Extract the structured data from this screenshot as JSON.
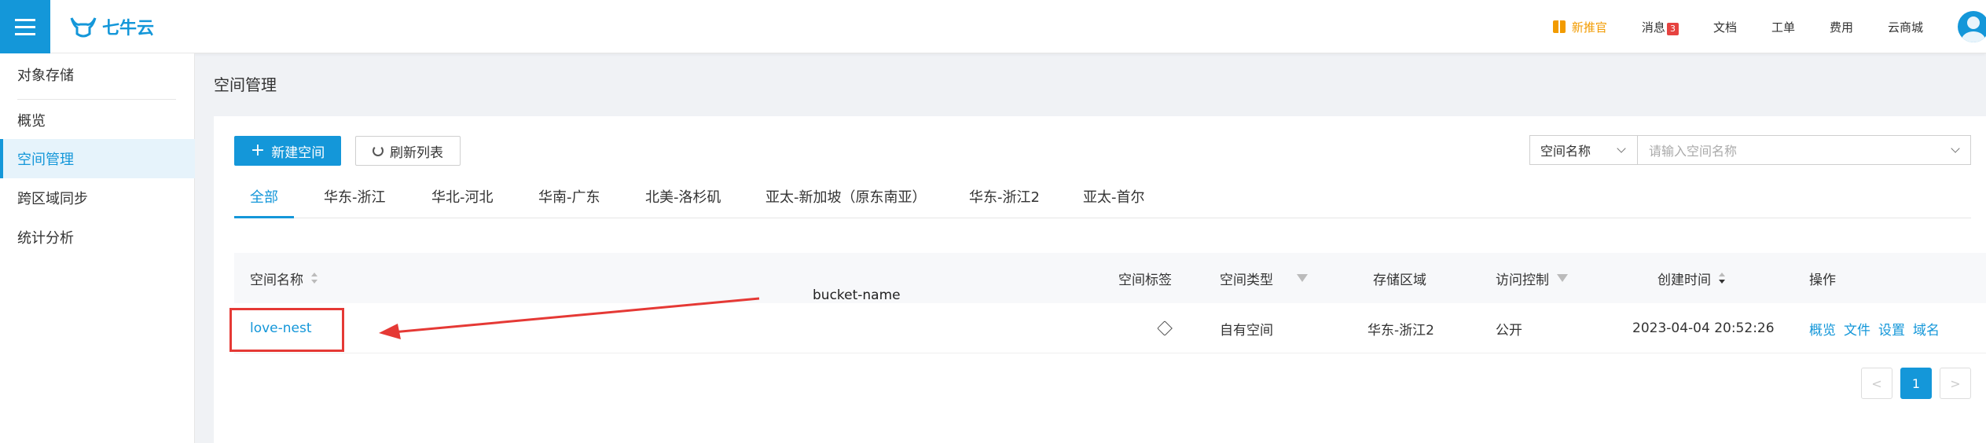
{
  "header": {
    "logo_text": "七牛云",
    "nav": {
      "promo": "新推官",
      "messages": "消息",
      "message_count": "3",
      "docs": "文档",
      "tickets": "工单",
      "billing": "费用",
      "store": "云商城"
    }
  },
  "sidebar": {
    "title": "对象存储",
    "items": [
      {
        "label": "概览"
      },
      {
        "label": "空间管理"
      },
      {
        "label": "跨区域同步"
      },
      {
        "label": "统计分析"
      }
    ]
  },
  "page_title": "空间管理",
  "toolbar": {
    "create_label": "新建空间",
    "refresh_label": "刷新列表",
    "search_field": "空间名称",
    "search_placeholder": "请输入空间名称"
  },
  "tabs": [
    "全部",
    "华东-浙江",
    "华北-河北",
    "华南-广东",
    "北美-洛杉矶",
    "亚太-新加坡（原东南亚）",
    "华东-浙江2",
    "亚太-首尔"
  ],
  "table": {
    "headers": {
      "name": "空间名称",
      "tags": "空间标签",
      "type": "空间类型",
      "region": "存储区域",
      "access": "访问控制",
      "created": "创建时间",
      "actions": "操作"
    },
    "rows": [
      {
        "name": "love-nest",
        "type": "自有空间",
        "region": "华东-浙江2",
        "access": "公开",
        "created": "2023-04-04 20:52:26",
        "actions": [
          "概览",
          "文件",
          "设置",
          "域名"
        ]
      }
    ]
  },
  "annotation": {
    "label": "bucket-name",
    "color": "#e53935"
  },
  "pagination": {
    "prev": "<",
    "current": "1",
    "next": ">"
  },
  "colors": {
    "accent": "#1497d9",
    "promo": "#f29b00"
  }
}
